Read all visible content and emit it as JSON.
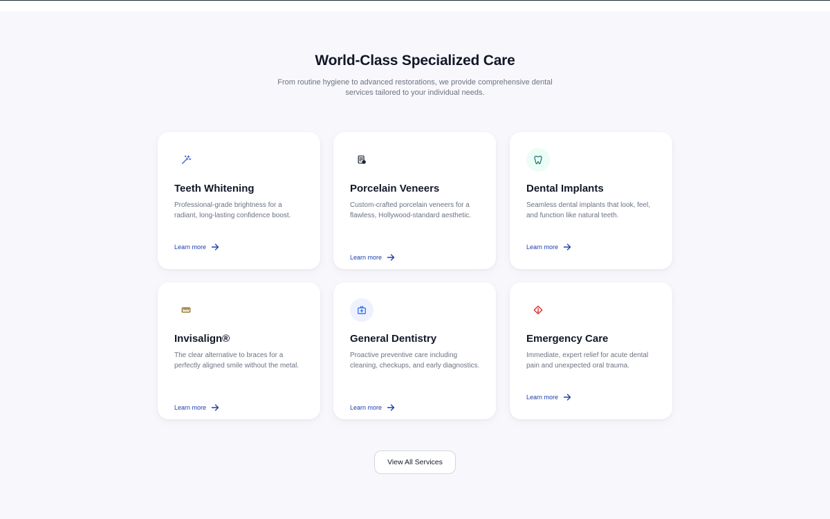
{
  "section": {
    "title": "World-Class Specialized Care",
    "subtitle": "From routine hygiene to advanced restorations, we provide comprehensive dental services tailored to your individual needs."
  },
  "services": [
    {
      "title": "Teeth Whitening",
      "description": "Professional-grade brightness for a radiant, long-lasting confidence boost.",
      "link": "Learn more",
      "icon": "magic-wand-icon",
      "icon_color": "#3b5bdb",
      "icon_bg": "#ffffff"
    },
    {
      "title": "Porcelain Veneers",
      "description": "Custom-crafted porcelain veneers for a flawless, Hollywood-standard aesthetic.",
      "link": "Learn more",
      "icon": "document-badge-icon",
      "icon_color": "#1f2937",
      "icon_bg": "#ffffff"
    },
    {
      "title": "Dental Implants",
      "description": "Seamless dental implants that look, feel, and function like natural teeth.",
      "link": "Learn more",
      "icon": "tooth-icon",
      "icon_color": "#0f766e",
      "icon_bg": "#ecfdf5"
    },
    {
      "title": "Invisalign®",
      "description": "The clear alternative to braces for a perfectly aligned smile without the metal.",
      "link": "Learn more",
      "icon": "aligner-icon",
      "icon_color": "#8a6d1f",
      "icon_bg": "#ffffff"
    },
    {
      "title": "General Dentistry",
      "description": "Proactive preventive care including cleaning, checkups, and early diagnostics.",
      "link": "Learn more",
      "icon": "medical-kit-icon",
      "icon_color": "#2563eb",
      "icon_bg": "#eef2ff"
    },
    {
      "title": "Emergency Care",
      "description": "Immediate, expert relief for acute dental pain and unexpected oral trauma.",
      "link": "Learn more",
      "icon": "alert-diamond-icon",
      "icon_color": "#dc2626",
      "icon_bg": "#ffffff"
    }
  ],
  "cta": {
    "label": "View All Services"
  },
  "colors": {
    "link": "#1e40af",
    "heading": "#111827",
    "body_text": "#6b7280",
    "section_bg": "#f8f8fc"
  }
}
